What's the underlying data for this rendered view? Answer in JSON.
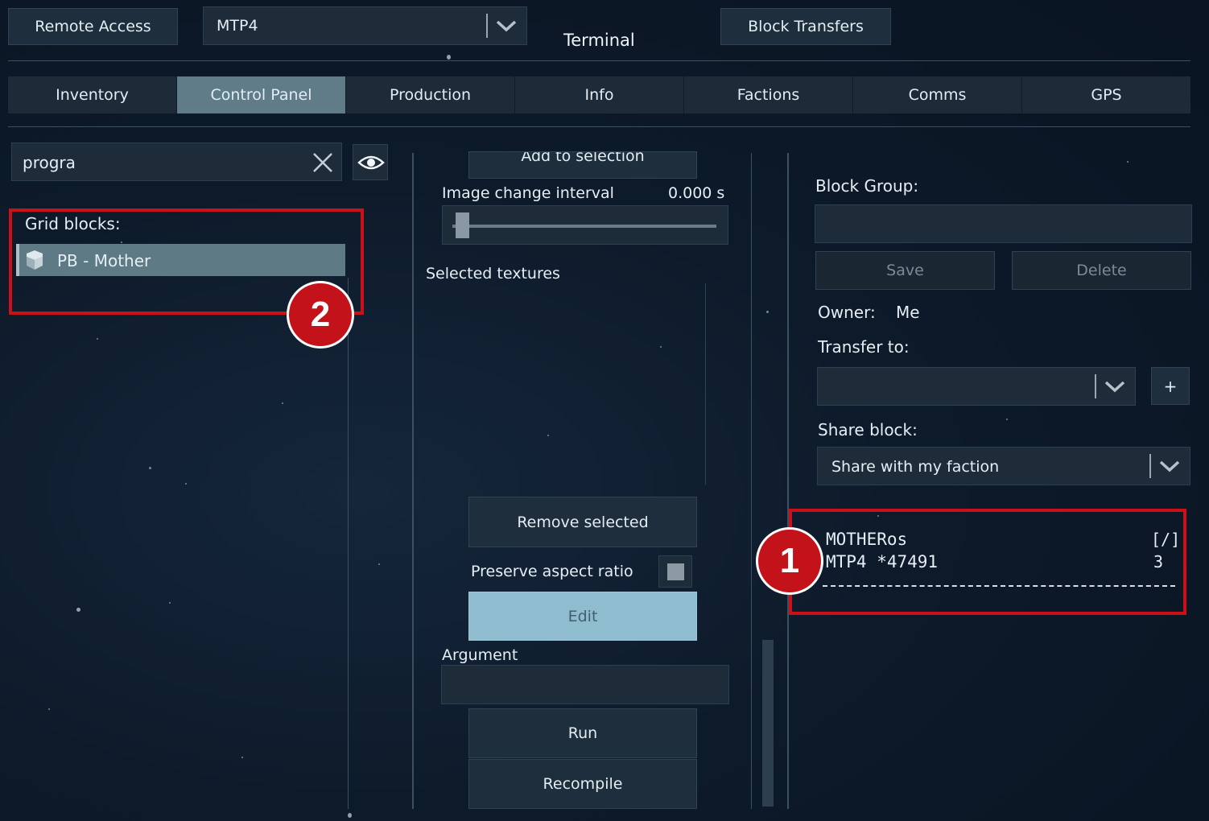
{
  "header": {
    "remote_access": "Remote Access",
    "grid_select": "MTP4",
    "title": "Terminal",
    "block_transfers": "Block Transfers"
  },
  "tabs": [
    {
      "label": "Inventory"
    },
    {
      "label": "Control Panel"
    },
    {
      "label": "Production"
    },
    {
      "label": "Info"
    },
    {
      "label": "Factions"
    },
    {
      "label": "Comms"
    },
    {
      "label": "GPS"
    }
  ],
  "search": {
    "value": "progra"
  },
  "grid_blocks": {
    "heading": "Grid blocks:",
    "items": [
      {
        "label": "PB - Mother"
      }
    ]
  },
  "middle": {
    "add_to_selection": "Add to selection",
    "image_interval_label": "Image change interval",
    "image_interval_value": "0.000 s",
    "image_interval_fraction": 0.0,
    "selected_textures": "Selected textures",
    "remove_selected": "Remove selected",
    "preserve_aspect": "Preserve aspect ratio",
    "edit": "Edit",
    "argument_label": "Argument",
    "argument_value": "",
    "run": "Run",
    "recompile": "Recompile"
  },
  "right": {
    "block_group_label": "Block Group:",
    "block_group_value": "",
    "save": "Save",
    "delete": "Delete",
    "owner_label": "Owner:",
    "owner_value": "Me",
    "transfer_label": "Transfer to:",
    "transfer_value": "",
    "add": "+",
    "share_label": "Share block:",
    "share_value": "Share with my faction",
    "detail_line1_left": "MOTHERos",
    "detail_line1_right": "[/]",
    "detail_line2_left": "MTP4 *47491",
    "detail_line2_right": "3"
  },
  "annotations": {
    "badge1": "1",
    "badge2": "2"
  },
  "colors": {
    "highlight": "#cc1018",
    "active_tab": "#5f7c88",
    "edit_button": "#8fbccf"
  }
}
